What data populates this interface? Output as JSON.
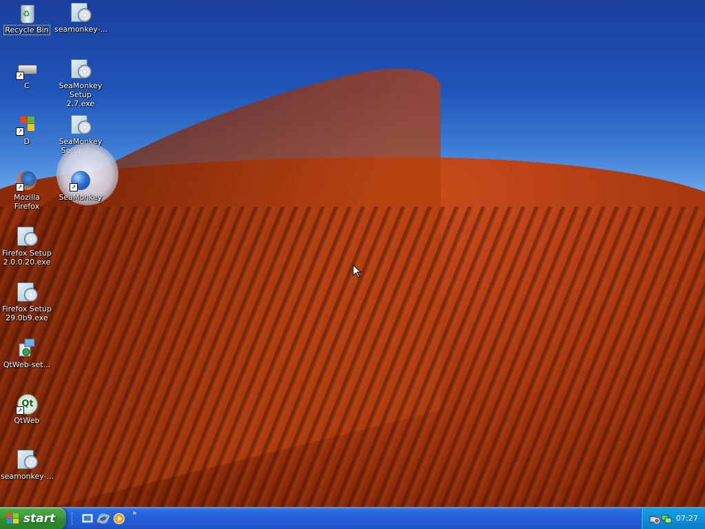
{
  "desktop": {
    "icons": [
      {
        "label": "Recycle Bin",
        "icon": "recycle-bin-icon"
      },
      {
        "label": "seamonkey-...",
        "icon": "installer-icon"
      },
      {
        "label": "C",
        "icon": "drive-icon"
      },
      {
        "label": "SeaMonkey Setup 2.7.exe",
        "icon": "installer-icon"
      },
      {
        "label": "D",
        "icon": "windows-logo-icon"
      },
      {
        "label": "SeaMonkey Setup 2....",
        "icon": "installer-icon"
      },
      {
        "label": "Mozilla Firefox",
        "icon": "firefox-icon"
      },
      {
        "label": "SeaMonkey",
        "icon": "seamonkey-icon"
      },
      {
        "label": "Firefox Setup 2.0.0.20.exe",
        "icon": "installer-icon"
      },
      {
        "label": "Firefox Setup 29.0b9.exe",
        "icon": "installer-icon"
      },
      {
        "label": "QtWeb-set...",
        "icon": "setup-icon"
      },
      {
        "label": "QtWeb",
        "icon": "qtweb-icon"
      },
      {
        "label": "seamonkey-...",
        "icon": "installer-icon"
      }
    ]
  },
  "taskbar": {
    "start_label": "start",
    "quicklaunch": [
      "show-desktop-icon",
      "internet-explorer-icon",
      "media-player-icon"
    ],
    "more": "»",
    "clock": "07:27"
  },
  "colors": {
    "taskbar_blue": "#245edb",
    "start_green": "#3c9a38",
    "tray_blue": "#0f8fd8"
  }
}
